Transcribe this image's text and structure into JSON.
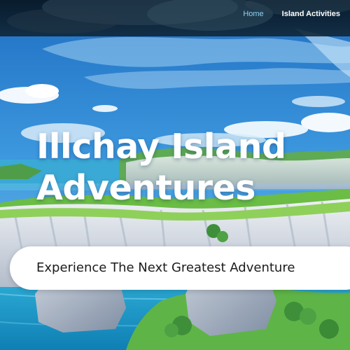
{
  "nav": {
    "links": [
      {
        "label": "Home",
        "active": true
      },
      {
        "label": "Island Activities",
        "active": false
      }
    ]
  },
  "hero": {
    "title_line1": "Illchay Island",
    "title_line2": "Adventures",
    "tagline": "Experience The Next Greatest Adventure"
  },
  "colors": {
    "nav_active": "#8fd3f4",
    "sky": "#2f8fd8",
    "sea": "#1fa3c9",
    "cliff": "#d8dde6",
    "grass": "#7cc44a"
  }
}
